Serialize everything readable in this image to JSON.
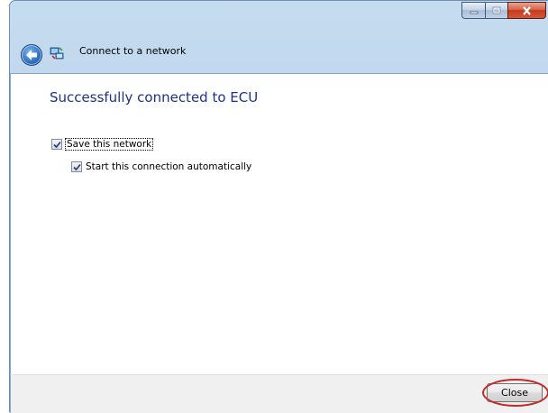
{
  "window": {
    "title": "Connect to a network",
    "caption_buttons": [
      "minimize",
      "maximize",
      "close"
    ]
  },
  "nav": {
    "back_icon": "back-arrow-icon",
    "network_icon": "network-icon"
  },
  "content": {
    "headline": "Successfully connected to ECU",
    "save_network": {
      "label": "Save this network",
      "checked": true
    },
    "start_auto": {
      "label": "Start this connection automatically",
      "checked": true
    }
  },
  "footer": {
    "close_label": "Close"
  },
  "colors": {
    "headline": "#1e3287",
    "highlight_ring": "#c62828"
  }
}
